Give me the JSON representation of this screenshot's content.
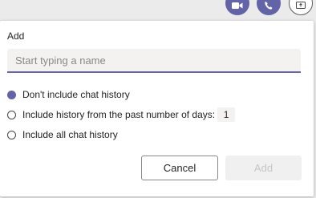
{
  "header": {
    "icons": [
      "video-call-icon",
      "audio-call-icon",
      "screen-share-icon"
    ]
  },
  "panel": {
    "title": "Add",
    "input": {
      "placeholder": "Start typing a name",
      "value": ""
    },
    "options": [
      {
        "label": "Don't include chat history",
        "selected": true
      },
      {
        "label": "Include history from the past number of days:",
        "selected": false
      },
      {
        "label": "Include all chat history",
        "selected": false
      }
    ],
    "days_value": "1",
    "buttons": {
      "cancel": "Cancel",
      "add": "Add"
    }
  },
  "colors": {
    "accent": "#6264a7",
    "input_bg": "#f3f2f1",
    "disabled_text": "#c8c6c4"
  }
}
